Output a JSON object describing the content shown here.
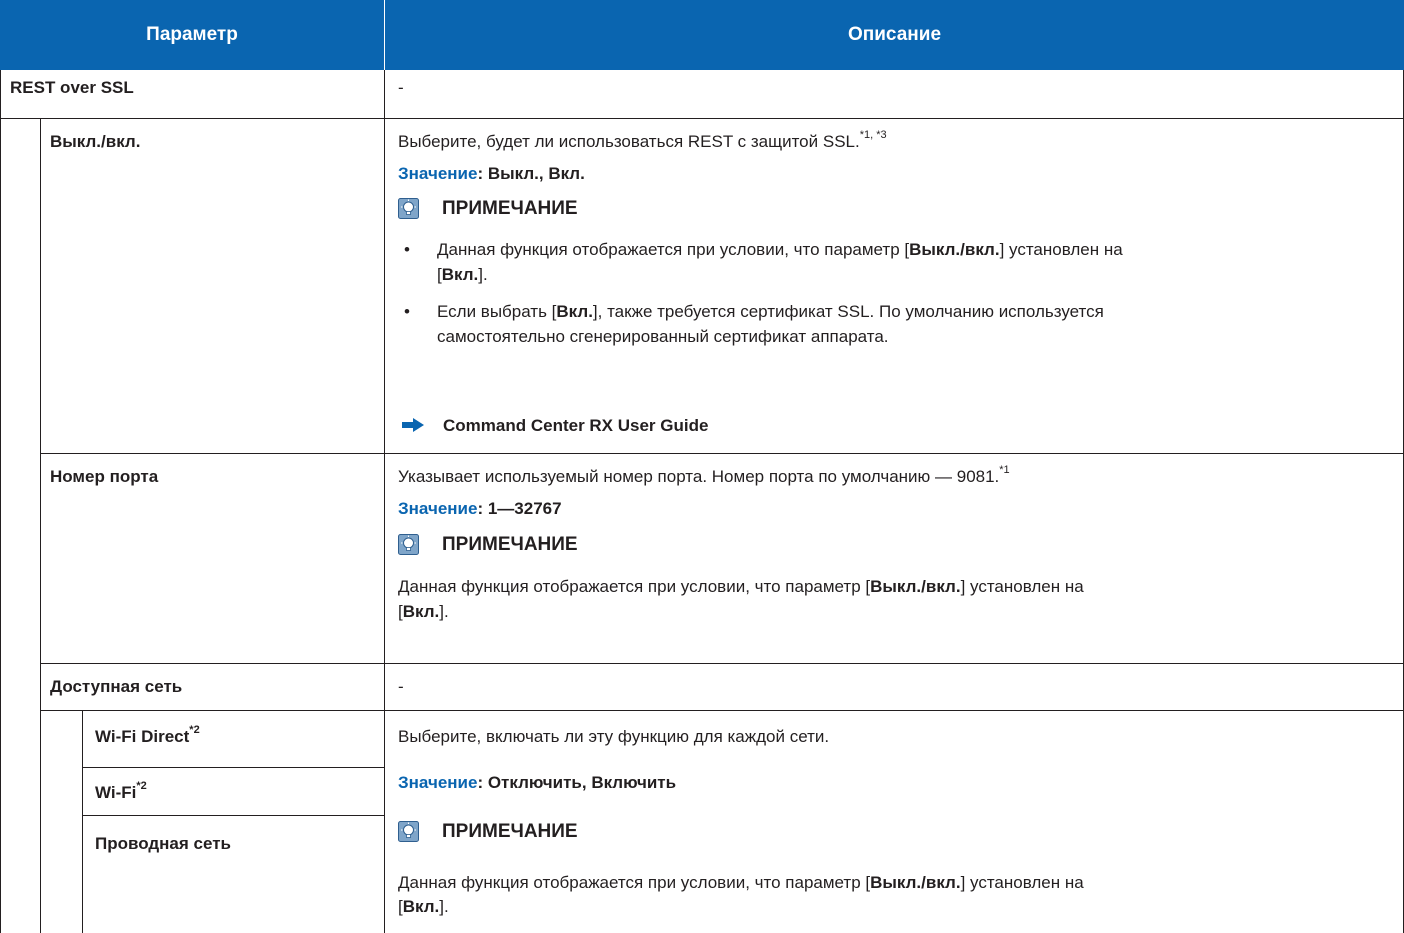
{
  "table": {
    "col_param": "Параметр",
    "col_desc": "Описание"
  },
  "rest": {
    "label": "REST over SSL",
    "desc": "-"
  },
  "onoff": {
    "label": "Выкл./вкл.",
    "desc_text": "Выберите, будет ли использоваться REST с защитой SSL.",
    "desc_sup": "*1, *3",
    "value_label": "Значение",
    "value_text": ": Выкл., Вкл.",
    "note_title": "ПРИМЕЧАНИЕ",
    "bullet1_a": "Данная функция отображается при условии, что параметр [",
    "bullet1_b": "Выкл./вкл.",
    "bullet1_c": "] установлен на",
    "bullet1_d": "[",
    "bullet1_e": "Вкл.",
    "bullet1_f": "].",
    "bullet2_a": "Если выбрать [",
    "bullet2_b": "Вкл.",
    "bullet2_c": "], также требуется сертификат SSL. По умолчанию используется",
    "bullet2_line2": "самостоятельно сгенерированный сертификат аппарата.",
    "bullet_char": "•",
    "ref": "Command Center RX User Guide"
  },
  "port": {
    "label": "Номер порта",
    "desc_text": "Указывает используемый номер порта. Номер порта по умолчанию — 9081.",
    "desc_sup": "*1",
    "value_label": "Значение",
    "value_text": ": 1—32767",
    "note_title": "ПРИМЕЧАНИЕ",
    "note_a": "Данная функция отображается при условии, что параметр [",
    "note_b": "Выкл./вкл.",
    "note_c": "] установлен на",
    "note_d": "[",
    "note_e": "Вкл.",
    "note_f": "]."
  },
  "network": {
    "label": "Доступная сеть",
    "desc": "-",
    "wifi_direct": "Wi-Fi Direct",
    "wifi_direct_sup": "*2",
    "wifi": "Wi-Fi",
    "wifi_sup": "*2",
    "wired": "Проводная сеть",
    "desc_text": "Выберите, включать ли эту функцию для каждой сети.",
    "value_label": "Значение",
    "value_text": ": Отключить, Включить",
    "note_title": "ПРИМЕЧАНИЕ",
    "note_a": "Данная функция отображается при условии, что параметр [",
    "note_b": "Выкл./вкл.",
    "note_c": "] установлен на",
    "note_d": "[",
    "note_e": "Вкл.",
    "note_f": "]."
  },
  "colors": {
    "header_bg": "#0a65b0",
    "value_label": "#0a65b0",
    "rule": "#231f20"
  }
}
